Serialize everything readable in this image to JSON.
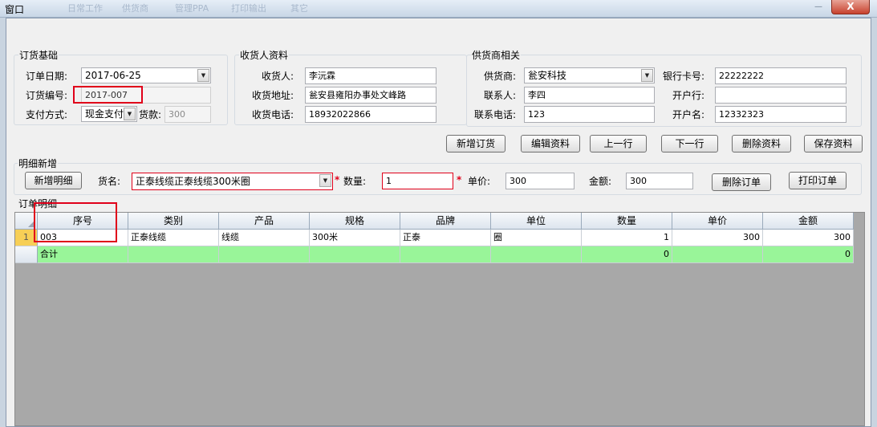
{
  "window": {
    "title": "窗口",
    "close": "X",
    "minimize": "—"
  },
  "background_tabs": [
    "日常工作",
    "供货商",
    "管理PPA",
    "打印输出",
    "其它"
  ],
  "basic": {
    "legend": "订货基础",
    "date_label": "订单日期:",
    "date_value": "2017-06-25",
    "no_label": "订货编号:",
    "no_value": "2017-007",
    "pay_label": "支付方式:",
    "pay_value": "现金支付",
    "amount_label": "货款:",
    "amount_value": "300"
  },
  "receiver": {
    "legend": "收货人资料",
    "name_label": "收货人:",
    "name_value": "李沅霖",
    "addr_label": "收货地址:",
    "addr_value": "瓮安县雍阳办事处文峰路",
    "phone_label": "收货电话:",
    "phone_value": "18932022866"
  },
  "supplier": {
    "legend": "供货商相关",
    "name_label": "供货商:",
    "name_value": "瓮安科技",
    "contact_label": "联系人:",
    "contact_value": "李四",
    "phone_label": "联系电话:",
    "phone_value": "123",
    "card_label": "银行卡号:",
    "card_value": "22222222",
    "bank_label": "开户行:",
    "bank_value": "",
    "holder_label": "开户名:",
    "holder_value": "12332323"
  },
  "actions": {
    "new_order": "新增订货",
    "edit": "编辑资料",
    "prev": "上一行",
    "next": "下一行",
    "delete": "删除资料",
    "save": "保存资料"
  },
  "detail": {
    "legend": "明细新增",
    "add_button": "新增明细",
    "goods_label": "货名:",
    "goods_value": "正泰线缆正泰线缆300米圈",
    "required_mark": "*",
    "qty_label": "数量:",
    "qty_value": "1",
    "price_label": "单价:",
    "price_value": "300",
    "amount_label": "金额:",
    "amount_value": "300",
    "delete_order": "删除订单",
    "print_order": "打印订单"
  },
  "grid": {
    "legend": "订单明细",
    "columns": [
      "序号",
      "类别",
      "产品",
      "规格",
      "品牌",
      "单位",
      "数量",
      "单价",
      "金额"
    ],
    "rows": [
      {
        "row_header": "1",
        "cells": [
          "003",
          "正泰线缆",
          "线缆",
          "300米",
          "正泰",
          "圈",
          "1",
          "300",
          "300"
        ]
      }
    ],
    "total": {
      "cells": [
        "合计",
        "",
        "",
        "",
        "",
        "",
        "0",
        "",
        "0"
      ]
    }
  },
  "colors": {
    "highlight": "#e0001a",
    "total_row": "#99f599",
    "grid_bg": "#a8a8a8",
    "row_header_active": "#f7cf56"
  }
}
